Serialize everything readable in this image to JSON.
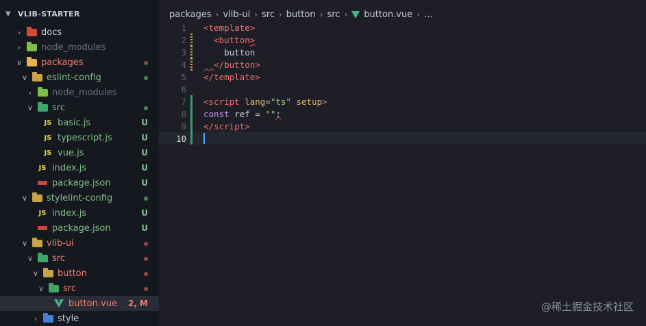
{
  "sidebar": {
    "title": "VLIB-STARTER",
    "items": [
      {
        "label": "docs",
        "indent": 0,
        "arrow": "right",
        "icon": "docs-folder-icon",
        "icon_color": "#d3493a",
        "color": "normal",
        "status": ""
      },
      {
        "label": "node_modules",
        "indent": 0,
        "arrow": "right",
        "icon": "node-modules-folder-icon",
        "icon_color": "#7dbf4a",
        "color": "dim",
        "status": ""
      },
      {
        "label": "packages",
        "indent": 0,
        "arrow": "down",
        "icon": "packages-folder-icon",
        "icon_color": "#e3b64e",
        "color": "red",
        "status": "dot",
        "status_color": "#8a4a4a"
      },
      {
        "label": "eslint-config",
        "indent": 1,
        "arrow": "down",
        "icon": "folder-icon",
        "icon_color": "#c9a24a",
        "color": "untracked",
        "status": "dot",
        "status_color": "#3f8a5a"
      },
      {
        "label": "node_modules",
        "indent": 2,
        "arrow": "right",
        "icon": "node-modules-folder-icon",
        "icon_color": "#7dbf4a",
        "color": "dim",
        "status": ""
      },
      {
        "label": "src",
        "indent": 2,
        "arrow": "down",
        "icon": "src-folder-icon",
        "icon_color": "#3fa66a",
        "color": "untracked",
        "status": "dot",
        "status_color": "#3f8a5a"
      },
      {
        "label": "basic.js",
        "indent": 3,
        "arrow": "none",
        "icon": "js-file-icon",
        "color": "untracked",
        "status": "U"
      },
      {
        "label": "typescript.js",
        "indent": 3,
        "arrow": "none",
        "icon": "js-file-icon",
        "color": "untracked",
        "status": "U"
      },
      {
        "label": "vue.js",
        "indent": 3,
        "arrow": "none",
        "icon": "js-file-icon",
        "color": "untracked",
        "status": "U"
      },
      {
        "label": "index.js",
        "indent": 2,
        "arrow": "none",
        "icon": "js-file-icon",
        "color": "untracked",
        "status": "U"
      },
      {
        "label": "package.json",
        "indent": 2,
        "arrow": "none",
        "icon": "json-file-icon",
        "color": "untracked",
        "status": "U"
      },
      {
        "label": "stylelint-config",
        "indent": 1,
        "arrow": "down",
        "icon": "folder-icon",
        "icon_color": "#c9a24a",
        "color": "untracked",
        "status": "dot",
        "status_color": "#3f8a5a"
      },
      {
        "label": "index.js",
        "indent": 2,
        "arrow": "none",
        "icon": "js-file-icon",
        "color": "untracked",
        "status": "U"
      },
      {
        "label": "package.json",
        "indent": 2,
        "arrow": "none",
        "icon": "json-file-icon",
        "color": "untracked",
        "status": "U"
      },
      {
        "label": "vlib-ui",
        "indent": 1,
        "arrow": "down",
        "icon": "folder-icon",
        "icon_color": "#c9a24a",
        "color": "red",
        "status": "dot",
        "status_color": "#8a4a4a"
      },
      {
        "label": "src",
        "indent": 2,
        "arrow": "down",
        "icon": "src-folder-icon",
        "icon_color": "#3fa66a",
        "color": "red",
        "status": "dot",
        "status_color": "#8a4a4a"
      },
      {
        "label": "button",
        "indent": 3,
        "arrow": "down",
        "icon": "folder-icon",
        "icon_color": "#c9a24a",
        "color": "red",
        "status": "dot",
        "status_color": "#8a4a4a"
      },
      {
        "label": "src",
        "indent": 4,
        "arrow": "down",
        "icon": "src-folder-icon",
        "icon_color": "#3fa66a",
        "color": "red",
        "status": "dot",
        "status_color": "#8a4a4a"
      },
      {
        "label": "button.vue",
        "indent": 5,
        "arrow": "none",
        "icon": "vue-file-icon",
        "color": "red",
        "status": "2, M",
        "selected": true
      },
      {
        "label": "style",
        "indent": 3,
        "arrow": "right",
        "icon": "style-folder-icon",
        "icon_color": "#4a7fd0",
        "color": "normal",
        "status": ""
      }
    ]
  },
  "breadcrumb": [
    "packages",
    "vlib-ui",
    "src",
    "button",
    "src",
    "button.vue",
    "..."
  ],
  "editor": {
    "active_line": 10,
    "lines": [
      {
        "n": "1",
        "gutter": "",
        "html": "<span class=\"tag\">&lt;template&gt;</span>"
      },
      {
        "n": "2",
        "gutter": "mod",
        "html": "  <span class=\"tag\">&lt;button<span class=\"squig\">&gt;</span></span>"
      },
      {
        "n": "3",
        "gutter": "mod",
        "html": "    button"
      },
      {
        "n": "4",
        "gutter": "mod",
        "html": "<span class=\"squig\">  </span><span class=\"tag\">&lt;/button&gt;</span>"
      },
      {
        "n": "5",
        "gutter": "",
        "html": "<span class=\"tag\">&lt;/template&gt;</span>"
      },
      {
        "n": "6",
        "gutter": "",
        "html": ""
      },
      {
        "n": "7",
        "gutter": "add",
        "html": "<span class=\"tag\">&lt;script</span> <span class=\"attr\">lang</span>=<span class=\"str\">\"ts\"</span> <span class=\"attr\">setup</span><span class=\"tag\">&gt;</span>"
      },
      {
        "n": "8",
        "gutter": "add",
        "html": "<span class=\"kw\">const</span> ref = <span class=\"str\">\"\"</span><span class=\"squig\">;</span>"
      },
      {
        "n": "9",
        "gutter": "add",
        "html": "<span class=\"tag\">&lt;/script&gt;</span>"
      },
      {
        "n": "10",
        "gutter": "add",
        "html": "<span class=\"cursor\"></span>"
      }
    ]
  },
  "watermark": "@稀土掘金技术社区",
  "colors": {
    "modified": "#e3b64e",
    "untracked": "#7fbf87",
    "red": "#f07f6f",
    "vue_green": "#41b883"
  }
}
